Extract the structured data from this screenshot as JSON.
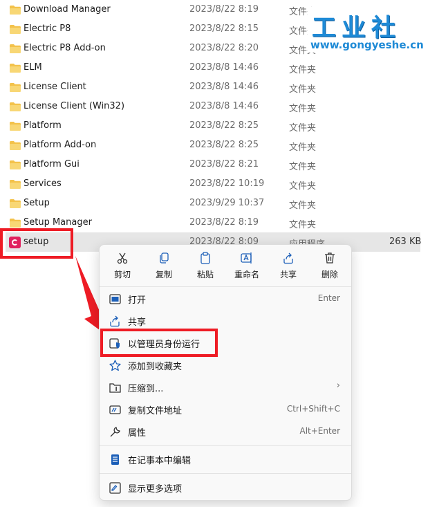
{
  "files": [
    {
      "name": "Download Manager",
      "date": "2023/8/22 8:19",
      "type": "文件夹",
      "size": "",
      "icon": "folder-icon"
    },
    {
      "name": "Electric P8",
      "date": "2023/8/22 8:15",
      "type": "文件夹",
      "size": "",
      "icon": "folder-icon"
    },
    {
      "name": "Electric P8 Add-on",
      "date": "2023/8/22 8:20",
      "type": "文件夹",
      "size": "",
      "icon": "folder-icon"
    },
    {
      "name": "ELM",
      "date": "2023/8/8 14:46",
      "type": "文件夹",
      "size": "",
      "icon": "folder-icon"
    },
    {
      "name": "License Client",
      "date": "2023/8/8 14:46",
      "type": "文件夹",
      "size": "",
      "icon": "folder-icon"
    },
    {
      "name": "License Client (Win32)",
      "date": "2023/8/8 14:46",
      "type": "文件夹",
      "size": "",
      "icon": "folder-icon"
    },
    {
      "name": "Platform",
      "date": "2023/8/22 8:25",
      "type": "文件夹",
      "size": "",
      "icon": "folder-icon"
    },
    {
      "name": "Platform Add-on",
      "date": "2023/8/22 8:25",
      "type": "文件夹",
      "size": "",
      "icon": "folder-icon"
    },
    {
      "name": "Platform Gui",
      "date": "2023/8/22 8:21",
      "type": "文件夹",
      "size": "",
      "icon": "folder-icon"
    },
    {
      "name": "Services",
      "date": "2023/8/22 10:19",
      "type": "文件夹",
      "size": "",
      "icon": "folder-icon"
    },
    {
      "name": "Setup",
      "date": "2023/9/29 10:37",
      "type": "文件夹",
      "size": "",
      "icon": "folder-icon"
    },
    {
      "name": "Setup Manager",
      "date": "2023/8/22 8:19",
      "type": "文件夹",
      "size": "",
      "icon": "folder-icon"
    },
    {
      "name": "setup",
      "date": "2023/8/22 8:09",
      "type": "应用程序",
      "size": "263 KB",
      "icon": "app-icon",
      "selected": true
    }
  ],
  "watermark": {
    "title": "工业社",
    "url": "www.gongyeshe.cn"
  },
  "context_menu": {
    "quick_actions": [
      {
        "label": "剪切",
        "icon": "cut-icon"
      },
      {
        "label": "复制",
        "icon": "copy-icon"
      },
      {
        "label": "粘贴",
        "icon": "paste-icon"
      },
      {
        "label": "重命名",
        "icon": "rename-icon"
      },
      {
        "label": "共享",
        "icon": "share-icon"
      },
      {
        "label": "删除",
        "icon": "delete-icon"
      }
    ],
    "items": [
      {
        "label": "打开",
        "shortcut": "Enter",
        "icon": "open-icon"
      },
      {
        "label": "共享",
        "shortcut": "",
        "icon": "share-icon"
      },
      {
        "label": "以管理员身份运行",
        "shortcut": "",
        "icon": "run-as-admin-icon",
        "highlighted": true
      },
      {
        "label": "添加到收藏夹",
        "shortcut": "",
        "icon": "star-icon"
      },
      {
        "label": "压缩到...",
        "shortcut": "",
        "icon": "compress-icon",
        "submenu": true
      },
      {
        "label": "复制文件地址",
        "shortcut": "Ctrl+Shift+C",
        "icon": "copy-path-icon"
      },
      {
        "label": "属性",
        "shortcut": "Alt+Enter",
        "icon": "properties-icon"
      },
      {
        "label": "在记事本中编辑",
        "shortcut": "",
        "icon": "notepad-icon"
      },
      {
        "label": "显示更多选项",
        "shortcut": "",
        "icon": "more-options-icon"
      }
    ],
    "submenu_chevron": "›"
  },
  "colors": {
    "accent": "#ee1c25",
    "folder": "#f3c24b",
    "watermark": "#1e8ad6",
    "selection": "#e6e6e6"
  }
}
